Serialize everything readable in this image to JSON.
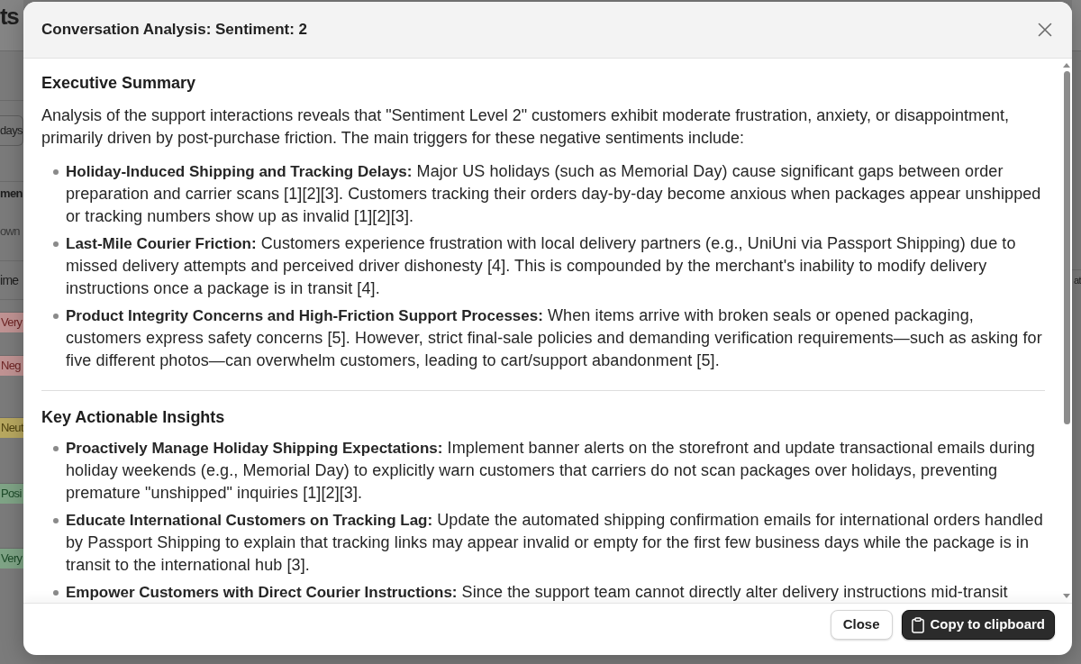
{
  "background_page": {
    "title": "ts",
    "filter_value": "days",
    "section_title": "men",
    "section_subtitle": "own",
    "column_header": "ime",
    "tags": [
      {
        "label": "Very",
        "color": "#c09393"
      },
      {
        "label": "Neg",
        "color": "#c09393"
      },
      {
        "label": "Neut",
        "color": "#b8a860"
      },
      {
        "label": "Posi",
        "color": "#7fa486"
      },
      {
        "label": "Very",
        "color": "#7fa486"
      }
    ],
    "right_edge_text": "at"
  },
  "dialog": {
    "title": "Conversation Analysis: Sentiment: 2",
    "sections": [
      {
        "heading": "Executive Summary",
        "intro": "Analysis of the support interactions reveals that \"Sentiment Level 2\" customers exhibit moderate frustration, anxiety, or disappointment, primarily driven by post-purchase friction. The main triggers for these negative sentiments include:",
        "bullets": [
          "**Holiday-Induced Shipping and Tracking Delays:** Major US holidays (such as Memorial Day) cause significant gaps between order preparation and carrier scans [1][2][3]. Customers tracking their orders day-by-day become anxious when packages appear unshipped or tracking numbers show up as invalid [1][2][3].",
          "**Last-Mile Courier Friction:** Customers experience frustration with local delivery partners (e.g., UniUni via Passport Shipping) due to missed delivery attempts and perceived driver dishonesty [4]. This is compounded by the merchant's inability to modify delivery instructions once a package is in transit [4].",
          "**Product Integrity Concerns and High-Friction Support Processes:** When items arrive with broken seals or opened packaging, customers express safety concerns [5]. However, strict final-sale policies and demanding verification requirements—such as asking for five different photos—can overwhelm customers, leading to cart/support abandonment [5]."
        ]
      },
      {
        "heading": "Key Actionable Insights",
        "bullets": [
          "**Proactively Manage Holiday Shipping Expectations:** Implement banner alerts on the storefront and update transactional emails during holiday weekends (e.g., Memorial Day) to explicitly warn customers that carriers do not scan packages over holidays, preventing premature \"unshipped\" inquiries [1][2][3].",
          "**Educate International Customers on Tracking Lag:** Update the automated shipping confirmation emails for international orders handled by Passport Shipping to explain that tracking links may appear invalid or empty for the first few business days while the package is in transit to the international hub [3].",
          "**Empower Customers with Direct Courier Instructions:** Since the support team cannot directly alter delivery instructions mid-transit"
        ]
      }
    ],
    "buttons": [
      {
        "label": "Close",
        "kind": "secondary"
      },
      {
        "label": "Copy to clipboard",
        "kind": "primary"
      }
    ]
  }
}
